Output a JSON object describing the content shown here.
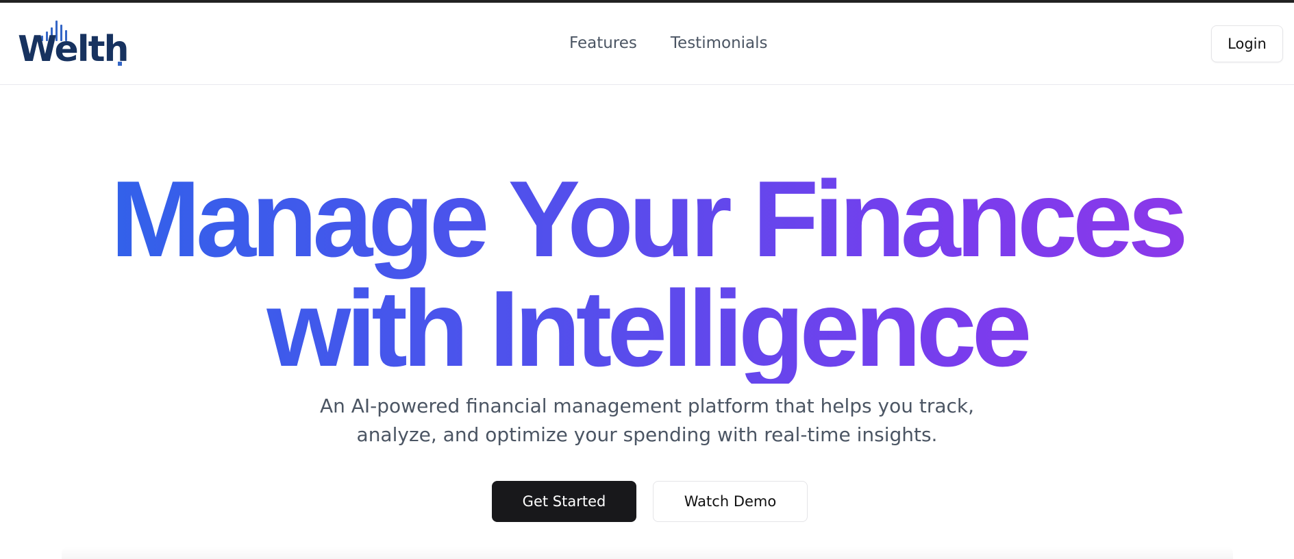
{
  "brand": {
    "name": "Welth",
    "colors": {
      "logo_text": "#17325f",
      "logo_bars": "#3466c7",
      "gradient_start": "#2f63ea",
      "gradient_end": "#9437e8",
      "primary_button": "#18181b"
    }
  },
  "header": {
    "nav": [
      {
        "label": "Features"
      },
      {
        "label": "Testimonials"
      }
    ],
    "login_label": "Login"
  },
  "hero": {
    "title_lines": [
      "Manage Your Finances",
      "with Intelligence"
    ],
    "subtitle_lines": [
      "An AI-powered financial management platform that helps you track,",
      "analyze, and optimize your spending with real-time insights."
    ],
    "primary_cta": "Get Started",
    "secondary_cta": "Watch Demo"
  }
}
